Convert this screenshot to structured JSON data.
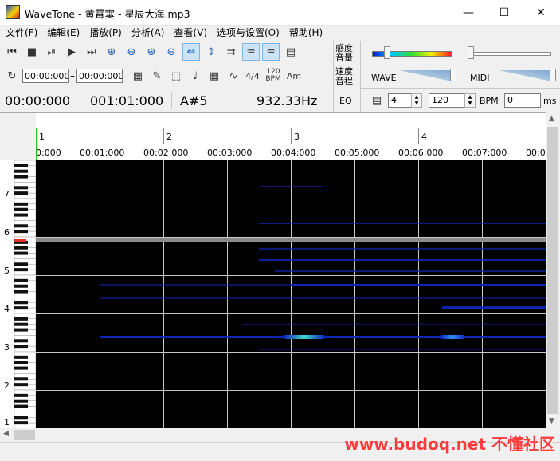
{
  "window": {
    "title": "WaveTone - 黄霄霙 - 星辰大海.mp3",
    "minimize": "—",
    "maximize": "☐",
    "close": "✕"
  },
  "menu": [
    "文件(F)",
    "编辑(E)",
    "播放(P)",
    "分析(A)",
    "查看(V)",
    "选项与设置(O)",
    "帮助(H)"
  ],
  "toolbar": {
    "time_start": "00:00:000",
    "time_sep": "–",
    "time_end": "00:00:000",
    "meter": "4/4",
    "bpm_label": "120 BPM",
    "key": "Am"
  },
  "readout": {
    "position": "00:00:000",
    "duration": "001:01:000",
    "note": "A#5",
    "frequency": "932.33Hz"
  },
  "panel": {
    "sensitivity": "感度",
    "volume": "音量",
    "speed": "速度",
    "pitch": "音程",
    "eq": "EQ",
    "wave": "WAVE",
    "midi": "MIDI",
    "beats": "4",
    "tempo": "120",
    "bpm": "BPM",
    "offset": "0",
    "ms": "ms"
  },
  "ruler": {
    "bars": [
      "1",
      "2",
      "3",
      "4"
    ],
    "times": [
      "0:000",
      "00:01:000",
      "00:02:000",
      "00:03:000",
      "00:04:000",
      "00:05:000",
      "00:06:000",
      "00:07:000",
      "00:0"
    ]
  },
  "keyboard": {
    "octaves": [
      "7",
      "6",
      "5",
      "4",
      "3",
      "2",
      "1"
    ]
  },
  "watermark": "www.budoq.net 不懂社区",
  "colors": {
    "spectrogram_bg": "#000000",
    "note_energy": "#1028c0",
    "peak": "#3fd9c8",
    "cursor_line": "#888888"
  }
}
